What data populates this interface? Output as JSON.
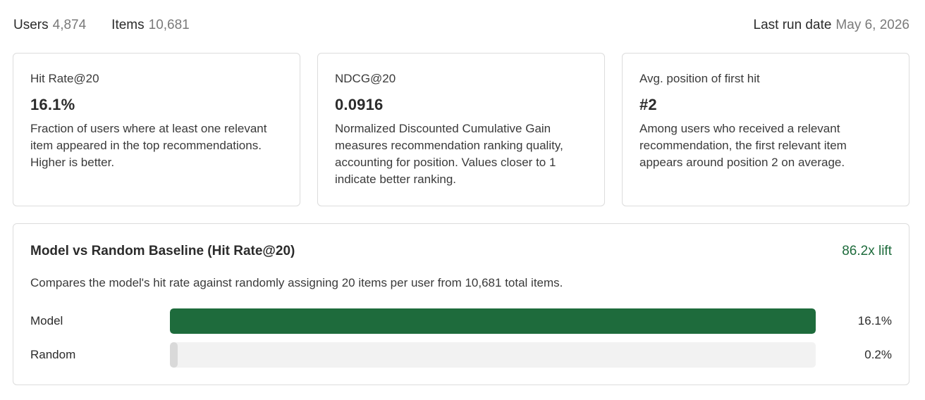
{
  "header": {
    "users_label": "Users",
    "users_value": "4,874",
    "items_label": "Items",
    "items_value": "10,681",
    "last_run_label": "Last run date",
    "last_run_value": "May 6, 2026"
  },
  "cards": [
    {
      "title": "Hit Rate@20",
      "value": "16.1%",
      "description": "Fraction of users where at least one relevant item appeared in the top recommendations. Higher is better."
    },
    {
      "title": "NDCG@20",
      "value": "0.0916",
      "description": "Normalized Discounted Cumulative Gain measures recommendation ranking quality, accounting for position. Values closer to 1 indicate better ranking."
    },
    {
      "title": "Avg. position of first hit",
      "value": "#2",
      "description": "Among users who received a relevant recommendation, the first relevant item appears around position 2 on average."
    }
  ],
  "comparison": {
    "title": "Model vs Random Baseline (Hit Rate@20)",
    "lift": "86.2x lift",
    "subtitle": "Compares the model's hit rate against randomly assigning 20 items per user from 10,681 total items.",
    "rows": [
      {
        "label": "Model",
        "value_text": "16.1%",
        "fill_fraction": 1.0,
        "color": "#1e6b3c"
      },
      {
        "label": "Random",
        "value_text": "0.2%",
        "fill_fraction": 0.012,
        "color": "#d9d9d9"
      }
    ]
  },
  "colors": {
    "accent_green": "#1e6b3c",
    "bar_track": "#f2f2f2",
    "border": "#dcdcdc"
  }
}
